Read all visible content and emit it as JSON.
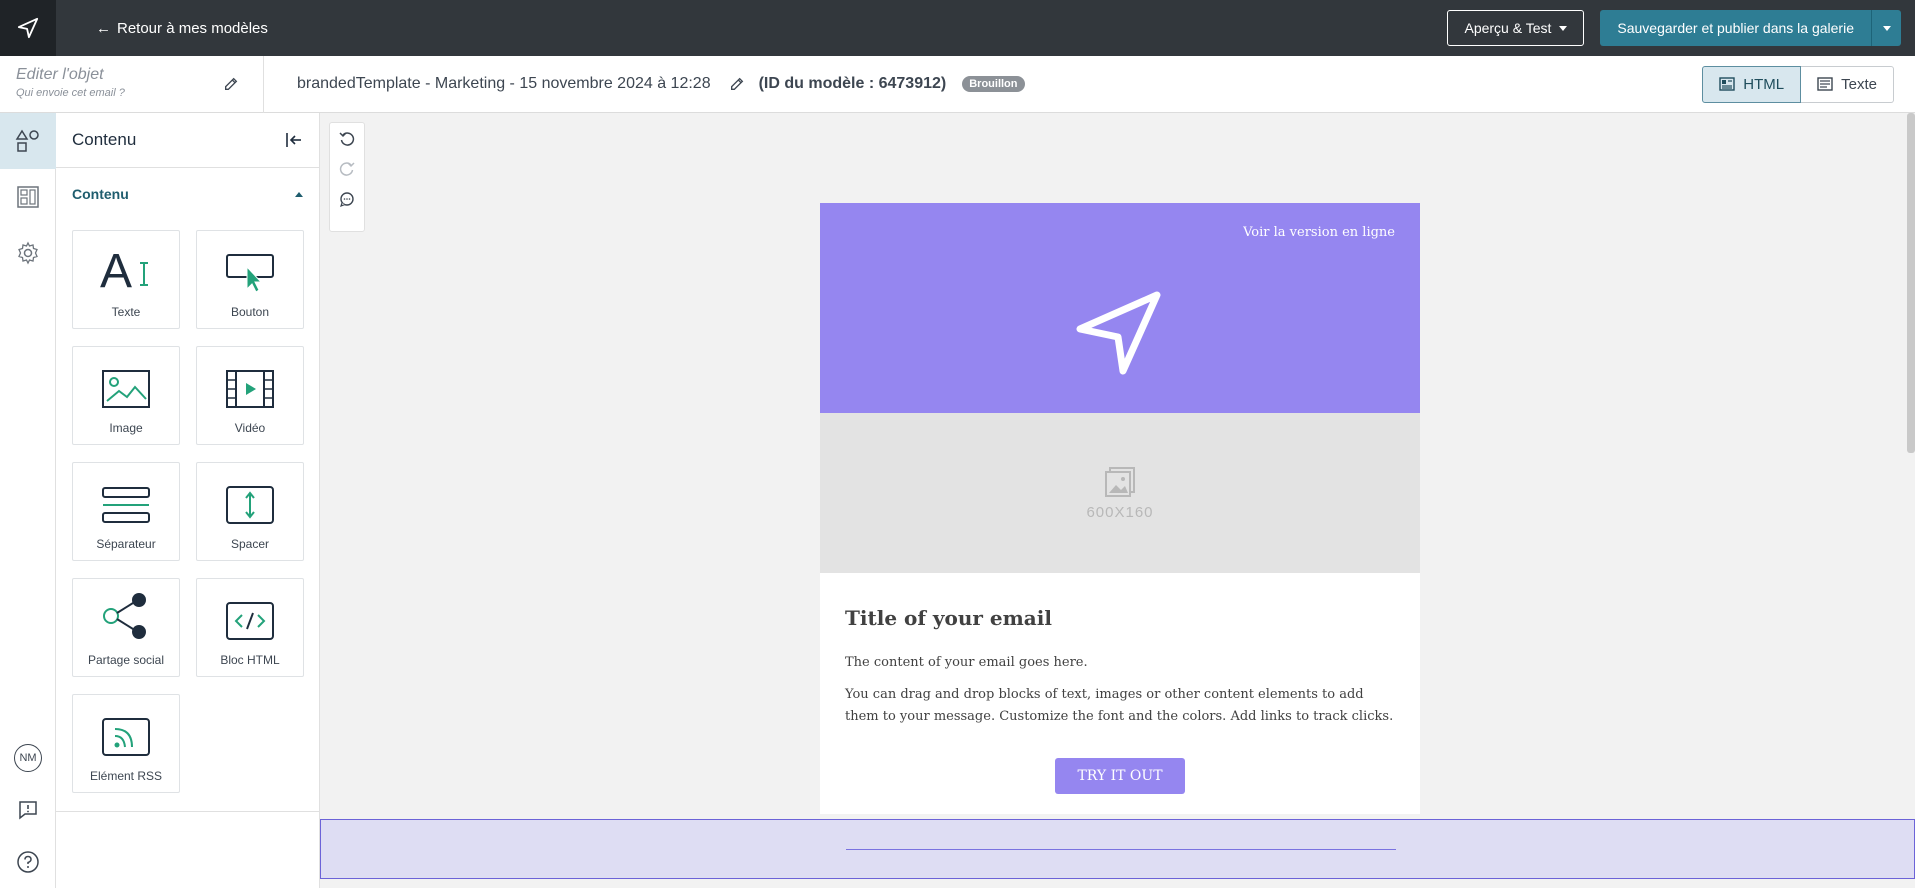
{
  "topbar": {
    "back_label": "Retour à mes modèles",
    "preview_label": "Aperçu & Test",
    "save_label": "Sauvegarder et publier dans la galerie"
  },
  "subbar": {
    "subject_placeholder": "Editer l'objet",
    "sender_placeholder": "Qui envoie cet email ?",
    "template_name": "brandedTemplate - Marketing - 15 novembre 2024 à 12:28",
    "template_id": "(ID du modèle : 6473912)",
    "status_badge": "Brouillon",
    "view_html": "HTML",
    "view_text": "Texte"
  },
  "rail": {
    "user_initials": "NM"
  },
  "panel": {
    "title": "Contenu",
    "section_title": "Contenu",
    "tiles": [
      {
        "label": "Texte",
        "icon": "text-icon"
      },
      {
        "label": "Bouton",
        "icon": "button-icon"
      },
      {
        "label": "Image",
        "icon": "image-icon"
      },
      {
        "label": "Vidéo",
        "icon": "video-icon"
      },
      {
        "label": "Séparateur",
        "icon": "divider-icon"
      },
      {
        "label": "Spacer",
        "icon": "spacer-icon"
      },
      {
        "label": "Partage social",
        "icon": "share-icon"
      },
      {
        "label": "Bloc HTML",
        "icon": "code-icon"
      },
      {
        "label": "Elément RSS",
        "icon": "rss-icon"
      }
    ]
  },
  "email": {
    "online_version": "Voir la version en ligne",
    "image_placeholder": "600X160",
    "title": "Title of your email",
    "paragraph1": "The content of your email goes here.",
    "paragraph2": "You can drag and drop blocks of text, images or other content elements to add them to your message. Customize the font and the colors. Add links to track clicks.",
    "cta_label": "TRY IT OUT"
  },
  "colors": {
    "topbar": "#32373c",
    "accent": "#2e7d94",
    "hero": "#9586f0"
  }
}
